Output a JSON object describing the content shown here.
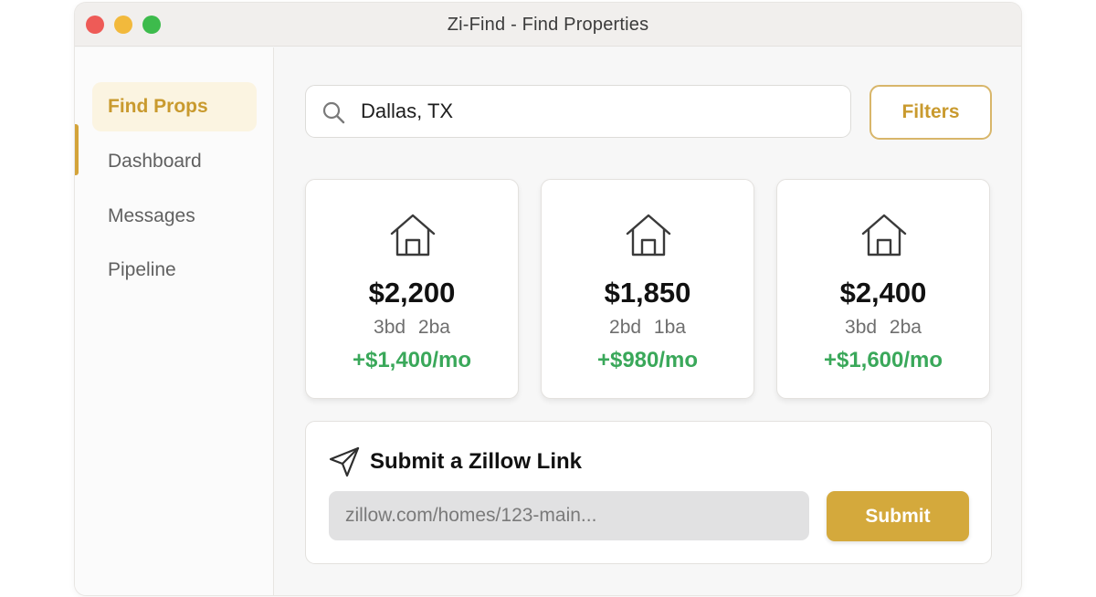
{
  "window": {
    "title": "Zi-Find - Find Properties"
  },
  "sidebar": {
    "items": [
      {
        "label": "Find Props",
        "active": true
      },
      {
        "label": "Dashboard",
        "active": false
      },
      {
        "label": "Messages",
        "active": false
      },
      {
        "label": "Pipeline",
        "active": false
      }
    ]
  },
  "search": {
    "value": "Dallas, TX",
    "icon": "search-icon"
  },
  "filters": {
    "label": "Filters"
  },
  "listings": [
    {
      "price": "$2,200",
      "beds": "3bd 2ba",
      "cashflow": "+$1,400/mo",
      "icon": "house-icon"
    },
    {
      "price": "$1,850",
      "beds": "2bd 1ba",
      "cashflow": "+$980/mo",
      "icon": "house-icon"
    },
    {
      "price": "$2,400",
      "beds": "3bd 2ba",
      "cashflow": "+$1,600/mo",
      "icon": "house-icon"
    }
  ],
  "submit_panel": {
    "title": "Submit a Zillow Link",
    "icon": "send-icon",
    "placeholder": "zillow.com/homes/123-main...",
    "button_label": "Submit"
  },
  "colors": {
    "accent": "#d4a93c",
    "accent_text": "#c99a2e",
    "active_bg": "#fbf4e1",
    "cashflow_green": "#3aa85a"
  }
}
